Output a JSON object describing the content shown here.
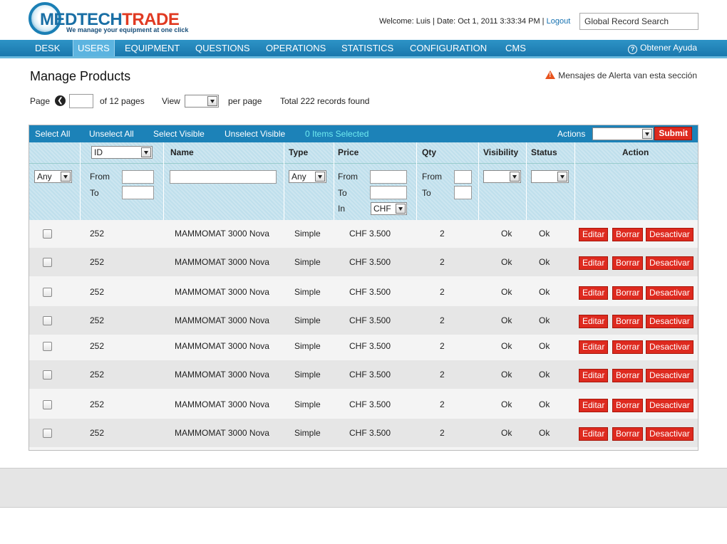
{
  "header": {
    "logo_text": "MEDTECHTRADE",
    "logo_tagline": "We manage your equipment at one click",
    "welcome": "Welcome: Luis | Date: Oct 1, 2011 3:33:34 PM |",
    "logout": "Logout",
    "search_value": "Global Record Search"
  },
  "nav": {
    "items": [
      "DESK",
      "USERS",
      "EQUIPMENT",
      "QUESTIONS",
      "OPERATIONS",
      "STATISTICS",
      "CONFIGURATION",
      "CMS"
    ],
    "active": "USERS",
    "help": "Obtener Ayuda"
  },
  "page": {
    "title": "Manage Products",
    "alert": "Mensajes de Alerta van esta sección"
  },
  "pager": {
    "page_label": "Page",
    "of_pages": "of 12 pages",
    "view_label": "View",
    "per_page": "per page",
    "total": "Total 222 records found"
  },
  "toolbar": {
    "select_all": "Select All",
    "unselect_all": "Unselect All",
    "select_visible": "Select Visible",
    "unselect_visible": "Unselect Visible",
    "items_selected": "0 Items Selected",
    "actions_label": "Actions",
    "submit": "Submit"
  },
  "columns": {
    "id_select": "ID",
    "name": "Name",
    "type": "Type",
    "price": "Price",
    "qty": "Qty",
    "visibility": "Visibility",
    "status": "Status",
    "action": "Action"
  },
  "filters": {
    "any": "Any",
    "from": "From",
    "to": "To",
    "in": "In",
    "currency": "CHF"
  },
  "row_buttons": {
    "edit": "Editar",
    "delete": "Borrar",
    "deactivate": "Desactivar"
  },
  "rows": [
    {
      "id": "252",
      "name": "MAMMOMAT 3000 Nova",
      "type": "Simple",
      "price": "CHF 3.500",
      "qty": "2",
      "visibility": "Ok",
      "status": "Ok"
    },
    {
      "id": "252",
      "name": "MAMMOMAT 3000 Nova",
      "type": "Simple",
      "price": "CHF 3.500",
      "qty": "2",
      "visibility": "Ok",
      "status": "Ok"
    },
    {
      "id": "252",
      "name": "MAMMOMAT 3000 Nova",
      "type": "Simple",
      "price": "CHF 3.500",
      "qty": "2",
      "visibility": "Ok",
      "status": "Ok"
    },
    {
      "id": "252",
      "name": "MAMMOMAT 3000 Nova",
      "type": "Simple",
      "price": "CHF 3.500",
      "qty": "2",
      "visibility": "Ok",
      "status": "Ok"
    },
    {
      "id": "252",
      "name": "MAMMOMAT 3000 Nova",
      "type": "Simple",
      "price": "CHF 3.500",
      "qty": "2",
      "visibility": "Ok",
      "status": "Ok"
    },
    {
      "id": "252",
      "name": "MAMMOMAT 3000 Nova",
      "type": "Simple",
      "price": "CHF 3.500",
      "qty": "2",
      "visibility": "Ok",
      "status": "Ok"
    },
    {
      "id": "252",
      "name": "MAMMOMAT 3000 Nova",
      "type": "Simple",
      "price": "CHF 3.500",
      "qty": "2",
      "visibility": "Ok",
      "status": "Ok"
    },
    {
      "id": "252",
      "name": "MAMMOMAT 3000 Nova",
      "type": "Simple",
      "price": "CHF 3.500",
      "qty": "2",
      "visibility": "Ok",
      "status": "Ok"
    }
  ]
}
